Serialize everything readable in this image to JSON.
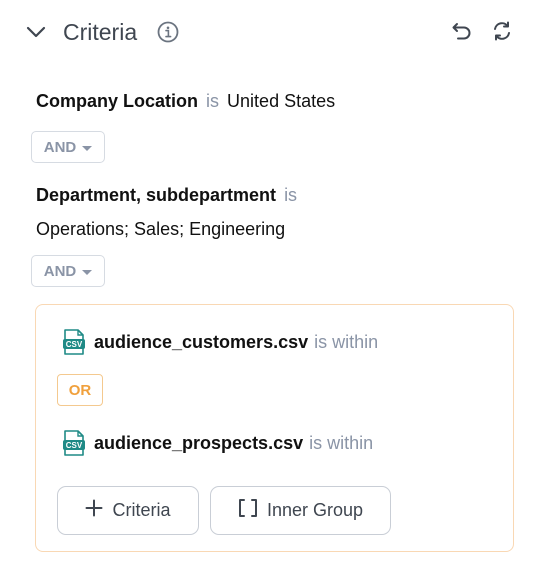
{
  "header": {
    "title": "Criteria"
  },
  "conditions": [
    {
      "field": "Company Location",
      "operator": "is",
      "value": "United States"
    },
    {
      "field": "Department, subdepartment",
      "operator": "is",
      "value": "Operations; Sales; Engineering"
    }
  ],
  "connectors": {
    "and_label": "AND",
    "or_label": "OR"
  },
  "group": {
    "files": [
      {
        "badge": "CSV",
        "name": "audience_customers.csv",
        "operator": "is within"
      },
      {
        "badge": "CSV",
        "name": "audience_prospects.csv",
        "operator": "is within"
      }
    ],
    "add_criteria_label": "Criteria",
    "inner_group_label": "Inner Group"
  },
  "colors": {
    "accent_orange": "#f0a03c",
    "group_border": "#f9d8b4",
    "csv_teal": "#1f8a86",
    "muted_text": "#8a94a6"
  },
  "icons": [
    "chevron-down-icon",
    "info-icon",
    "undo-icon",
    "refresh-icon",
    "csv-file-icon",
    "plus-icon",
    "brackets-icon"
  ]
}
